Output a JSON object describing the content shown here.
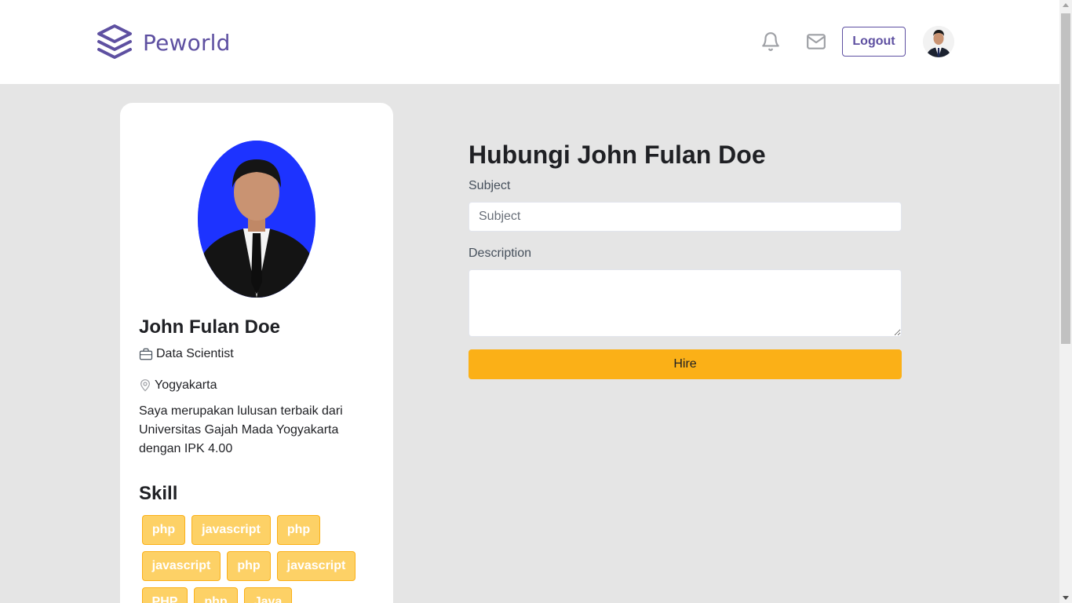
{
  "navbar": {
    "brand_name": "Peworld",
    "brand_color": "#5e50a1",
    "notification_icon": "bell-icon",
    "mail_icon": "mail-icon",
    "logout_label": "Logout"
  },
  "profile": {
    "name": "John Fulan Doe",
    "job_title": "Data Scientist",
    "location": "Yogyakarta",
    "bio": "Saya merupakan lulusan terbaik dari Universitas Gajah Mada Yogyakarta dengan IPK 4.00",
    "skill_heading": "Skill",
    "skills": [
      "php",
      "javascript",
      "php",
      "javascript",
      "php",
      "javascript",
      "PHP",
      "php",
      "Java"
    ]
  },
  "contact_form": {
    "title": "Hubungi John Fulan Doe",
    "subject_label": "Subject",
    "subject_placeholder": "Subject",
    "subject_value": "",
    "description_label": "Description",
    "description_value": "",
    "hire_label": "Hire"
  },
  "colors": {
    "accent": "#5e50a1",
    "hire_button": "#fbb017",
    "skill_chip_bg": "#fdd166",
    "page_bg": "#e5e5e5"
  }
}
